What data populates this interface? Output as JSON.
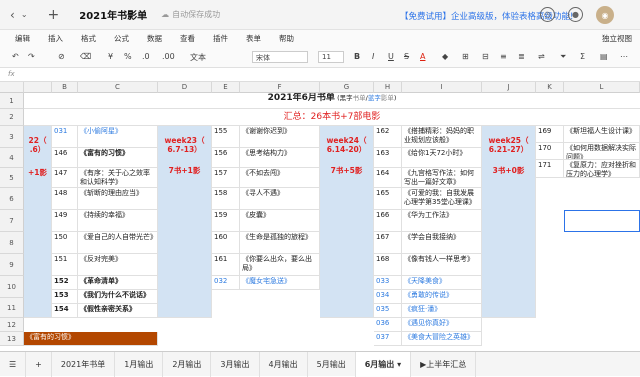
{
  "titlebar": {
    "doc_title": "2021年书影单",
    "autosave": "自动保存成功",
    "promo": "【免费试用】企业高级版，体验表格高级功能!"
  },
  "menu": [
    "编辑",
    "插入",
    "格式",
    "公式",
    "数据",
    "查看",
    "插件",
    "表单",
    "帮助"
  ],
  "menu_standalone": "独立视图",
  "toolbar": {
    "percent": "%",
    "decimal0": ".0",
    "decimal00": ".00",
    "text_label": "文本",
    "font": "宋体",
    "size": "11"
  },
  "sheet": {
    "columns": [
      "B",
      "C",
      "D",
      "E",
      "F",
      "G",
      "H",
      "I",
      "J",
      "K",
      "L"
    ],
    "rows": [
      "1",
      "2",
      "3",
      "4",
      "5",
      "6",
      "7",
      "8",
      "9",
      "10",
      "11",
      "12",
      "13",
      "14",
      "15"
    ],
    "header_title": "2021年6月书单",
    "header_legend_black": "黑字",
    "header_legend_book": "书单",
    "header_legend_blue": "蓝字",
    "header_legend_movie": "影单",
    "summary": "汇总：26本书+7部电影",
    "weeks": [
      {
        "label": "22（\n.6）",
        "count": "+1影"
      },
      {
        "label": "week23（\n6.7-13）",
        "count": "7书+1影"
      },
      {
        "label": "week24（\n6.14-20）",
        "count": "7书+5影"
      },
      {
        "label": "week25（\n6.21-27）",
        "count": "3书+0影"
      }
    ],
    "colB": [
      "031",
      "146",
      "147",
      "148",
      "149",
      "150",
      "151",
      "152",
      "153",
      "154"
    ],
    "colC": [
      "《小偷阿星》",
      "《富有的习惯》",
      "《有序：关于心之效率和认知科学》",
      "《斩断的理由应当》",
      "《持续的幸福》",
      "《爱自己的人自带光芒》",
      "《反对完美》",
      "《革命清单》",
      "《我们为什么不说话》",
      "《假性亲密关系》"
    ],
    "colE": [
      "155",
      "156",
      "157",
      "158",
      "159",
      "160",
      "161",
      "032"
    ],
    "colF": [
      "《谢谢你迟到》",
      "《思考结构力》",
      "《不如去闯》",
      "《寻人不遇》",
      "《皮囊》",
      "《生命是孤独的旅程》",
      "《你要么出众，要么出局》",
      "《魔女宅急送》"
    ],
    "colH": [
      "162",
      "163",
      "164",
      "165",
      "166",
      "167",
      "168",
      "033",
      "034",
      "035",
      "036",
      "037"
    ],
    "colI": [
      "《搭捕精彩：妈妈的职业规划应该般》",
      "《给你1天72小时》",
      "《九宫格写作法：如何写出一篇好文章》",
      "《可爱的我：自我发展心理学第35堂心理课》",
      "《华为工作法》",
      "《学会自我接纳》",
      "《像有钱人一样思考》",
      "《天降美食》",
      "《勇敢的传说》",
      "《疯狂·潘》",
      "《遇见你真好》",
      "《美食大冒险之英雄》"
    ],
    "colK": [
      "169",
      "170",
      "171"
    ],
    "colL": [
      "《斯坦福人生设计课》",
      "《如何用数据解决实际问题》",
      "《复原力：应对挫折和压力的心理学》"
    ],
    "footer_note": "《富有的习惯》"
  },
  "tabs": [
    "2021年书单",
    "1月输出",
    "2月输出",
    "3月输出",
    "4月输出",
    "5月输出",
    "6月输出",
    "上半年汇总"
  ],
  "icon_add": "+",
  "icon_back": "‹",
  "icon_refresh": "↻"
}
